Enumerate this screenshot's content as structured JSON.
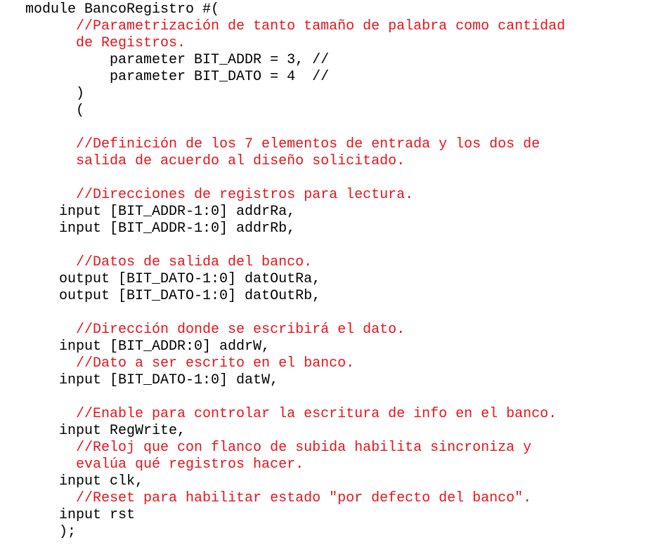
{
  "colors": {
    "code_text": "#000000",
    "comment_text": "#e8141a",
    "background": "#ffffff"
  },
  "code_lines": [
    {
      "indent": "   ",
      "text": "module BancoRegistro #(",
      "kind": "code"
    },
    {
      "indent": "         ",
      "text": "//Parametrización de tanto tamaño de palabra como cantidad",
      "kind": "comment"
    },
    {
      "indent": "         ",
      "text": "de Registros.",
      "kind": "comment"
    },
    {
      "indent": "             ",
      "text": "parameter BIT_ADDR = 3, //",
      "kind": "code"
    },
    {
      "indent": "             ",
      "text": "parameter BIT_DATO = 4  //",
      "kind": "code"
    },
    {
      "indent": "         ",
      "text": ")",
      "kind": "code"
    },
    {
      "indent": "         ",
      "text": "(",
      "kind": "code"
    },
    {
      "indent": "",
      "text": "",
      "kind": "blank"
    },
    {
      "indent": "         ",
      "text": "//Definición de los 7 elementos de entrada y los dos de",
      "kind": "comment"
    },
    {
      "indent": "         ",
      "text": "salida de acuerdo al diseño solicitado.",
      "kind": "comment"
    },
    {
      "indent": "",
      "text": "",
      "kind": "blank"
    },
    {
      "indent": "         ",
      "text": "//Direcciones de registros para lectura.",
      "kind": "comment"
    },
    {
      "indent": "       ",
      "text": "input [BIT_ADDR-1:0] addrRa,",
      "kind": "code"
    },
    {
      "indent": "       ",
      "text": "input [BIT_ADDR-1:0] addrRb,",
      "kind": "code"
    },
    {
      "indent": "",
      "text": "",
      "kind": "blank"
    },
    {
      "indent": "         ",
      "text": "//Datos de salida del banco.",
      "kind": "comment"
    },
    {
      "indent": "       ",
      "text": "output [BIT_DATO-1:0] datOutRa,",
      "kind": "code"
    },
    {
      "indent": "       ",
      "text": "output [BIT_DATO-1:0] datOutRb,",
      "kind": "code"
    },
    {
      "indent": "",
      "text": "",
      "kind": "blank"
    },
    {
      "indent": "         ",
      "text": "//Dirección donde se escribirá el dato.",
      "kind": "comment"
    },
    {
      "indent": "       ",
      "text": "input [BIT_ADDR:0] addrW,",
      "kind": "code"
    },
    {
      "indent": "         ",
      "text": "//Dato a ser escrito en el banco.",
      "kind": "comment"
    },
    {
      "indent": "       ",
      "text": "input [BIT_DATO-1:0] datW,",
      "kind": "code"
    },
    {
      "indent": "",
      "text": "",
      "kind": "blank"
    },
    {
      "indent": "         ",
      "text": "//Enable para controlar la escritura de info en el banco.",
      "kind": "comment"
    },
    {
      "indent": "       ",
      "text": "input RegWrite,",
      "kind": "code"
    },
    {
      "indent": "         ",
      "text": "//Reloj que con flanco de subida habilita sincroniza y",
      "kind": "comment"
    },
    {
      "indent": "         ",
      "text": "evalúa qué registros hacer.",
      "kind": "comment"
    },
    {
      "indent": "       ",
      "text": "input clk,",
      "kind": "code"
    },
    {
      "indent": "         ",
      "text": "//Reset para habilitar estado \"por defecto del banco\".",
      "kind": "comment"
    },
    {
      "indent": "       ",
      "text": "input rst",
      "kind": "code"
    },
    {
      "indent": "       ",
      "text": ");",
      "kind": "code"
    }
  ]
}
